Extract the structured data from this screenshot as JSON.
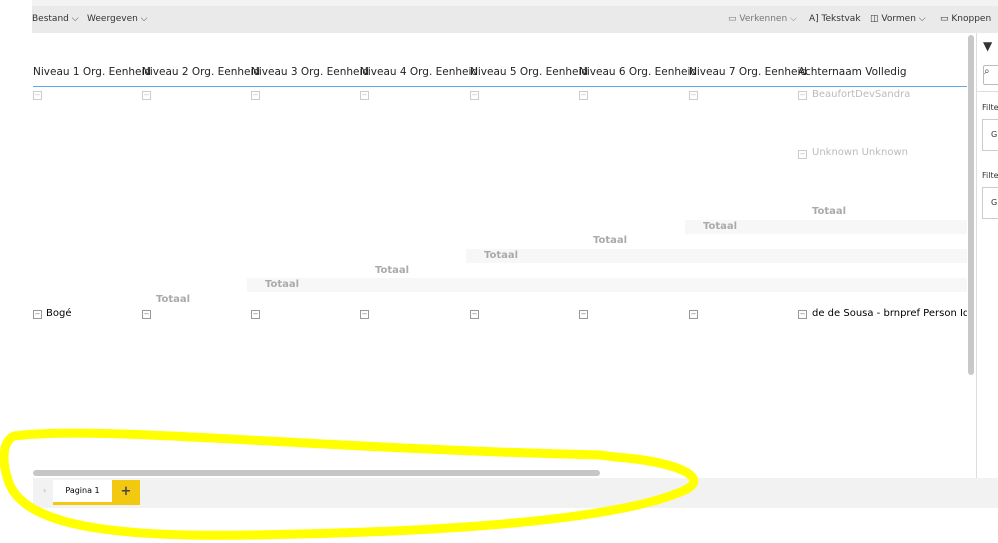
{
  "toolbar": {
    "left": [
      "Bestand",
      "Weergeven"
    ],
    "verkennen": "Verkennen",
    "tekstvak": "Tekstvak",
    "vormen": "Vormen",
    "knoppen": "Knoppen"
  },
  "table": {
    "headers": [
      "Niveau 1 Org. Eenheid",
      "Niveau 2 Org. Eenheid",
      "Niveau 3 Org. Eenheid",
      "Niveau 4 Org. Eenheid",
      "Niveau 5 Org. Eenheid",
      "Niveau 6 Org. Eenheid",
      "Niveau 7 Org. Eenheid",
      "Achternaam Volledig"
    ],
    "row1_name": "BeaufortDevSandra",
    "row2_name": "Unknown Unknown",
    "total_label": "Totaal",
    "last_row_level1": "Bogé",
    "last_row_name": "de de Sousa - brnpref Person Idefi"
  },
  "filter_pane": {
    "label1": "Filter",
    "label2": "Filter",
    "value1": "G",
    "value2": "G"
  },
  "pages": {
    "tab": "Pagina 1",
    "add": "+"
  },
  "colors": {
    "accent": "#f2c811",
    "header_line": "#5ea9e6",
    "annotation": "#ffff00"
  }
}
